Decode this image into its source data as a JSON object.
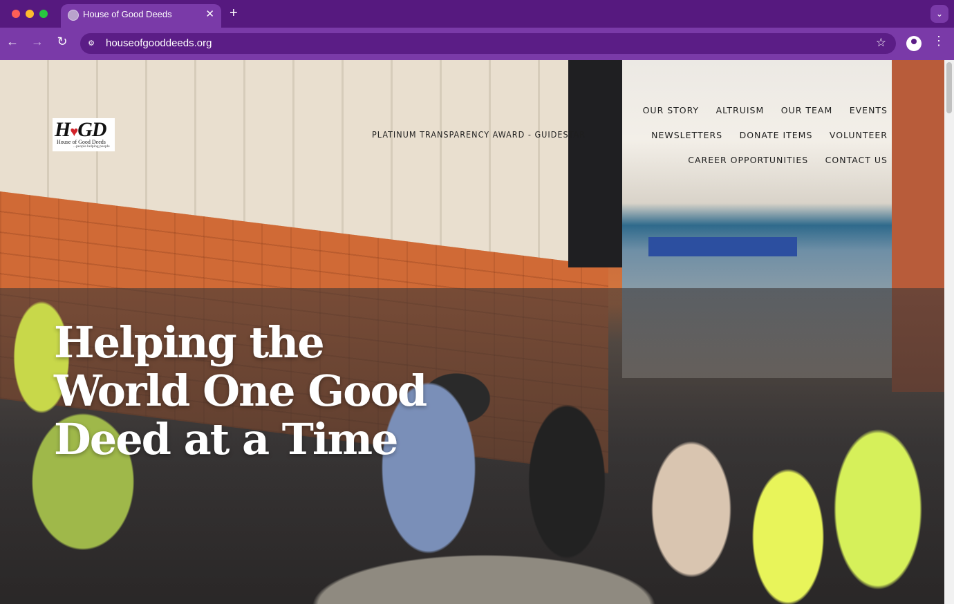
{
  "browser": {
    "tab_title": "House of Good Deeds",
    "tab_close": "✕",
    "new_tab": "+",
    "tab_menu": "⌄",
    "url": "houseofgooddeeds.org",
    "icons": {
      "back": "arrow-left-icon",
      "forward": "arrow-right-icon",
      "reload": "reload-icon",
      "site_info": "tune-icon",
      "bookmark": "star-icon",
      "profile": "profile-icon",
      "menu": "kebab-menu-icon"
    }
  },
  "site": {
    "logo": {
      "mark": "H GD",
      "subtitle": "House of Good Deeds",
      "tagline": "...people helping people"
    },
    "award_link": "PLATINUM TRANSPARENCY AWARD - GUIDESTAR",
    "nav": {
      "row1": [
        "OUR STORY",
        "ALTRUISM",
        "OUR TEAM",
        "EVENTS"
      ],
      "row2": [
        "NEWSLETTERS",
        "DONATE ITEMS",
        "VOLUNTEER"
      ],
      "row3": [
        "CAREER OPPORTUNITIES",
        "CONTACT US"
      ]
    },
    "hero": {
      "heading": "Helping the World One Good Deed at a Time"
    }
  }
}
